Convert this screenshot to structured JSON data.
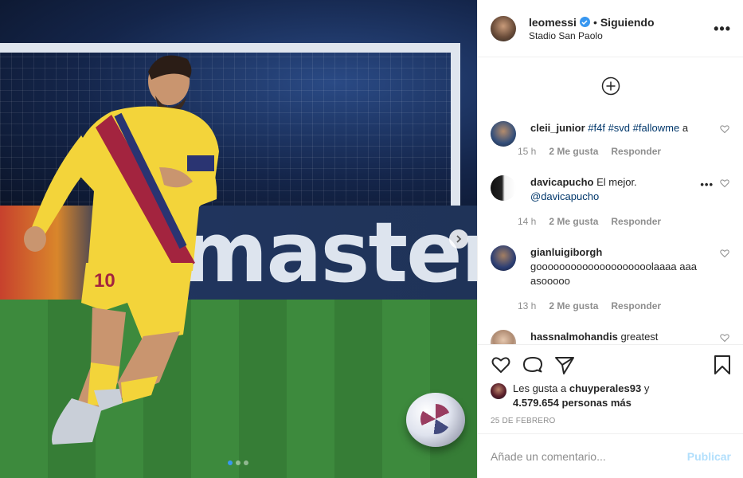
{
  "post": {
    "photo_label": "mastercard",
    "carousel": {
      "count": 3,
      "active": 0
    }
  },
  "header": {
    "username": "leomessi",
    "separator": "•",
    "follow_label": "Siguiendo",
    "location": "Stadio San Paolo",
    "more_icon": "more-icon"
  },
  "comments": [
    {
      "username": "cleii_junior",
      "text": "",
      "tags": [
        "#f4f",
        "#svd",
        "#fallowme"
      ],
      "trail": "a",
      "time": "15 h",
      "likes": "2 Me gusta",
      "reply": "Responder"
    },
    {
      "username": "davicapucho",
      "text": "El mejor.",
      "tags": [
        "@davicapucho"
      ],
      "trail": "",
      "time": "14 h",
      "likes": "2 Me gusta",
      "reply": "Responder"
    },
    {
      "username": "gianluigiborgh",
      "text": "goooooooooooooooooooolaaaa aaaasooooo",
      "tags": [],
      "trail": "",
      "time": "13 h",
      "likes": "2 Me gusta",
      "reply": "Responder"
    },
    {
      "username": "hassnalmohandis",
      "text": "greatest",
      "tags": [],
      "trail": "",
      "time": "",
      "likes": "",
      "reply": ""
    }
  ],
  "likes": {
    "prefix": "Les gusta a",
    "user": "chuyperales93",
    "joiner": "y",
    "others": "4.579.654 personas más"
  },
  "date": "25 DE FEBRERO",
  "composer": {
    "placeholder": "Añade un comentario...",
    "post_label": "Publicar"
  },
  "colors": {
    "link": "#00376b",
    "verified": "#3897f0",
    "muted": "#8e8e8e",
    "publish_disabled": "#b2dffc"
  }
}
